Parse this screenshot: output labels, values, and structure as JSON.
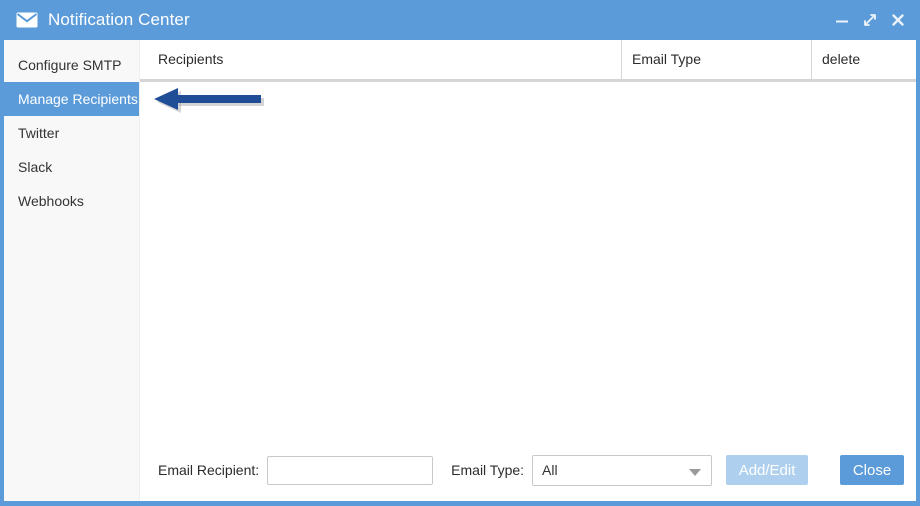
{
  "window": {
    "title": "Notification Center",
    "icon": "envelope-icon",
    "titlebar_color": "#5b9bd9",
    "controls": [
      {
        "name": "minimize-button",
        "icon": "minimize-icon"
      },
      {
        "name": "maximize-button",
        "icon": "expand-diagonal-icon"
      },
      {
        "name": "close-button",
        "icon": "close-x-icon"
      }
    ]
  },
  "sidebar": {
    "items": [
      {
        "label": "Configure SMTP",
        "selected": false
      },
      {
        "label": "Manage Recipients",
        "selected": true
      },
      {
        "label": "Twitter",
        "selected": false
      },
      {
        "label": "Slack",
        "selected": false
      },
      {
        "label": "Webhooks",
        "selected": false
      }
    ],
    "selected_color": "#5b9bd9",
    "background": "#f8f8f8"
  },
  "table": {
    "columns": [
      {
        "label": "Recipients"
      },
      {
        "label": "Email Type"
      },
      {
        "label": "delete"
      }
    ],
    "rows": []
  },
  "annotation": {
    "type": "left-arrow",
    "color": "#1f4e96"
  },
  "footer": {
    "recipient_label": "Email Recipient:",
    "recipient_value": "",
    "recipient_placeholder": "",
    "email_type_label": "Email Type:",
    "email_type_value": "All",
    "email_type_options": [
      "All"
    ],
    "add_edit_label": "Add/Edit",
    "close_label": "Close",
    "add_edit_color": "#aed0ee",
    "close_color": "#5b9bd9"
  }
}
